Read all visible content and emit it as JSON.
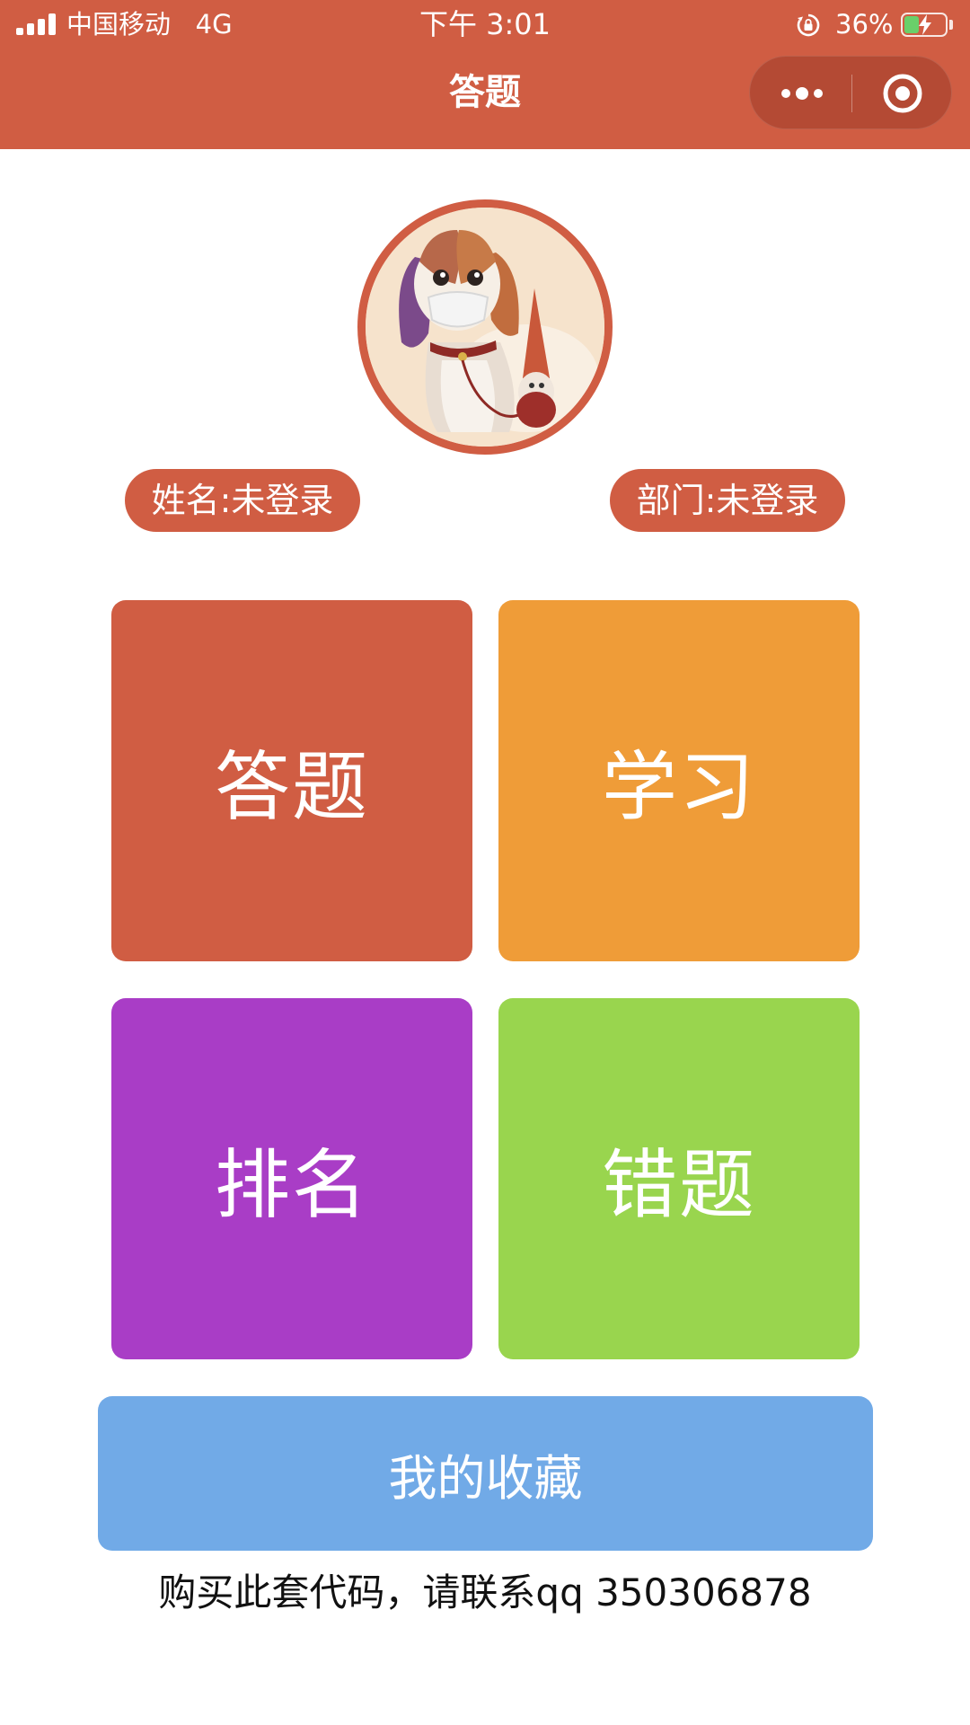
{
  "status_bar": {
    "carrier": "中国移动",
    "network": "4G",
    "time": "下午 3:01",
    "battery": "36%",
    "battery_level": 0.36
  },
  "nav": {
    "title": "答题",
    "more_icon": "ellipsis-icon",
    "close_icon": "target-icon"
  },
  "profile": {
    "avatar_icon": "dog-avatar",
    "name_label": "姓名:未登录",
    "department_label": "部门:未登录"
  },
  "tiles": [
    {
      "label": "答题",
      "color": "#d05d43"
    },
    {
      "label": "学习",
      "color": "#ef9c38"
    },
    {
      "label": "排名",
      "color": "#a93dc6"
    },
    {
      "label": "错题",
      "color": "#99d54e"
    }
  ],
  "favorites": {
    "label": "我的收藏",
    "color": "#71aae7"
  },
  "footer": {
    "note": "购买此套代码，请联系qq 350306878"
  },
  "colors": {
    "accent": "#d05d43"
  }
}
